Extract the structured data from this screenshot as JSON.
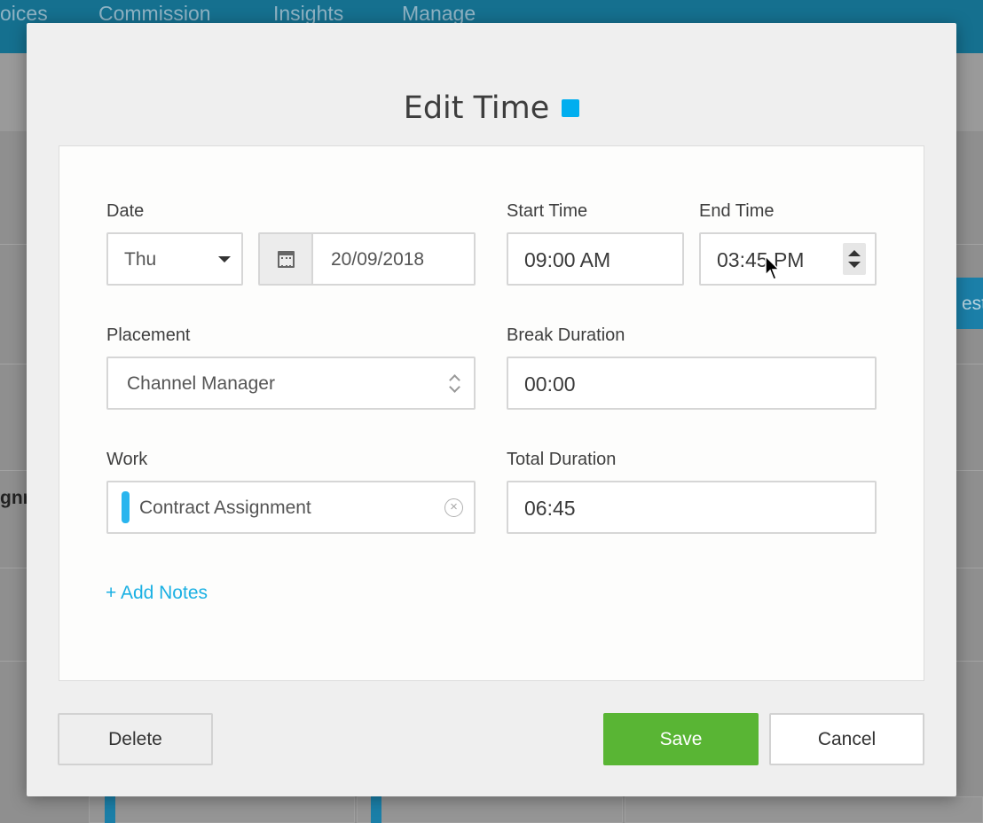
{
  "background": {
    "nav_items": [
      "oices",
      "Commission",
      "Insights",
      "Manage"
    ],
    "side_button_text": "est",
    "side_text": "gnr"
  },
  "modal": {
    "title": "Edit Time",
    "title_swatch_color": "#00aeef",
    "fields": {
      "date_label": "Date",
      "day_value": "Thu",
      "date_value": "20/09/2018",
      "start_time_label": "Start Time",
      "start_time_value": "09:00 AM",
      "end_time_label": "End Time",
      "end_time_value": "03:45 PM",
      "placement_label": "Placement",
      "placement_value": "Channel Manager",
      "break_duration_label": "Break Duration",
      "break_duration_value": "00:00",
      "work_label": "Work",
      "work_value": "Contract Assignment",
      "work_color": "#29b5ee",
      "total_duration_label": "Total Duration",
      "total_duration_value": "06:45"
    },
    "add_notes": "+ Add Notes",
    "buttons": {
      "delete": "Delete",
      "save": "Save",
      "cancel": "Cancel"
    }
  },
  "icons": {
    "calendar": "calendar-icon",
    "dropdown": "caret-down-icon",
    "spinner": "spinner-up-down-icon",
    "select_arrows": "chevron-up-down-icon",
    "clear": "clear-circle-icon",
    "cursor": "mouse-pointer-icon"
  },
  "colors": {
    "save_green": "#59b534",
    "link_blue": "#1ab0e3",
    "nav_blue": "#15708f"
  }
}
